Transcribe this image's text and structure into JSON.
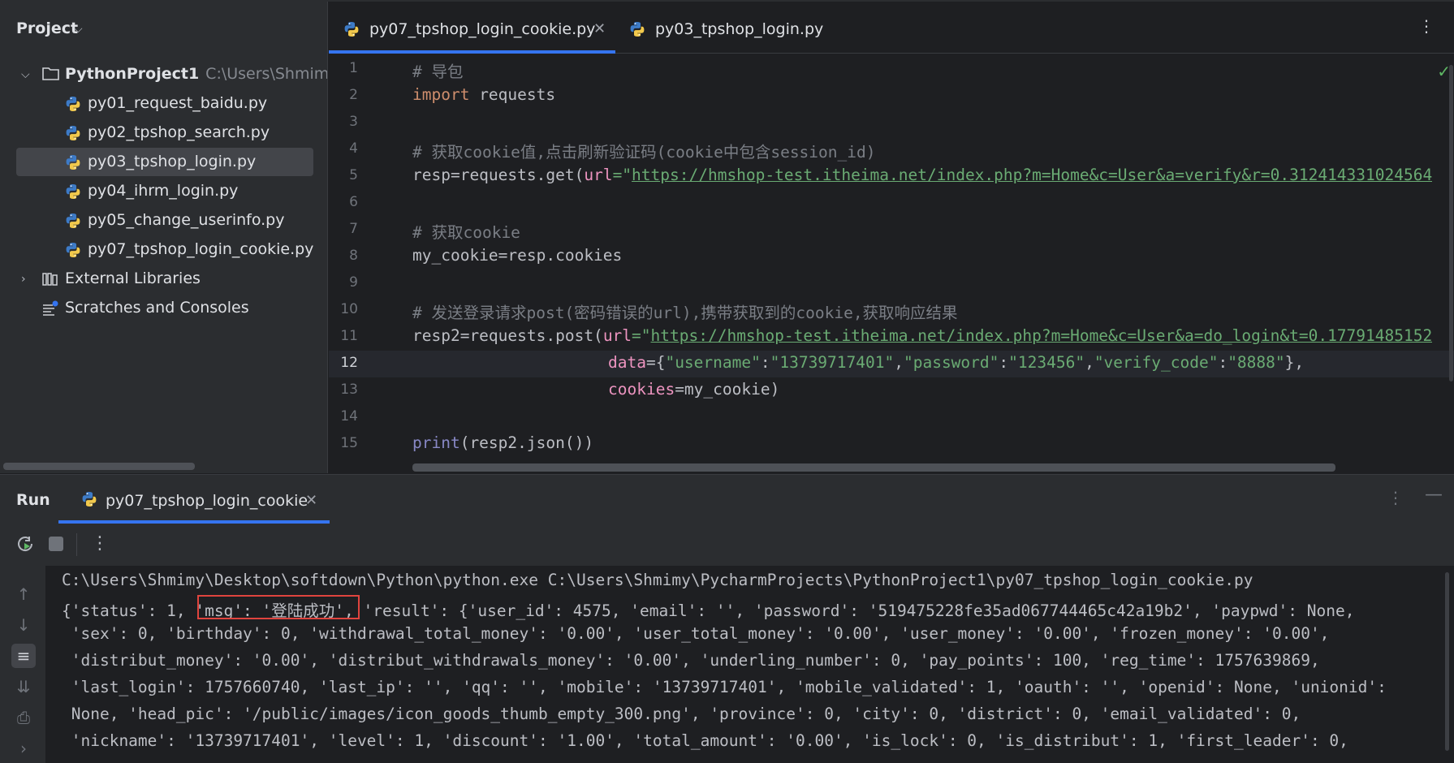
{
  "project_panel": {
    "title": "Project",
    "root": {
      "name": "PythonProject1",
      "path": "C:\\Users\\Shmimy\\Py"
    },
    "files": [
      "py01_request_baidu.py",
      "py02_tpshop_search.py",
      "py03_tpshop_login.py",
      "py04_ihrm_login.py",
      "py05_change_userinfo.py",
      "py07_tpshop_login_cookie.py"
    ],
    "selected_file": "py03_tpshop_login.py",
    "external_libraries": "External Libraries",
    "scratches": "Scratches and Consoles"
  },
  "editor": {
    "tabs": [
      {
        "label": "py07_tpshop_login_cookie.py",
        "active": true
      },
      {
        "label": "py03_tpshop_login.py",
        "active": false
      }
    ],
    "current_line": 12,
    "line_numbers": [
      "1",
      "2",
      "3",
      "4",
      "5",
      "6",
      "7",
      "8",
      "9",
      "10",
      "11",
      "12",
      "13",
      "14",
      "15"
    ],
    "code": {
      "l1": "# 导包",
      "l2_kw": "import",
      "l2_rest": " requests",
      "l4": "# 获取cookie值,点击刷新验证码(cookie中包含session_id)",
      "l5_a": "resp=requests.get(",
      "l5_param": "url",
      "l5_eq": "=\"",
      "l5_url": "https://hmshop-test.itheima.net/index.php?m=Home&c=User&a=verify&r=0.312414331024564",
      "l7": "# 获取cookie",
      "l8": "my_cookie=resp.cookies",
      "l10": "# 发送登录请求post(密码错误的url),携带获取到的cookie,获取响应结果",
      "l11_a": "resp2=requests.post(",
      "l11_param": "url",
      "l11_eq": "=\"",
      "l11_url": "https://hmshop-test.itheima.net/index.php?m=Home&c=User&a=do_login&t=0.17791485152",
      "l12_param": "data",
      "l12_a": "={",
      "l12_k1": "\"username\"",
      "l12_v1": "\"13739717401\"",
      "l12_k2": "\"password\"",
      "l12_v2": "\"123456\"",
      "l12_k3": "\"verify_code\"",
      "l12_v3": "\"8888\"",
      "l12_end": "},",
      "l13_param": "cookies",
      "l13_rest": "=my_cookie)",
      "l15_fn": "print",
      "l15_rest": "(resp2.json())"
    }
  },
  "run_panel": {
    "title": "Run",
    "tab_label": "py07_tpshop_login_cookie",
    "console": [
      "C:\\Users\\Shmimy\\Desktop\\softdown\\Python\\python.exe C:\\Users\\Shmimy\\PycharmProjects\\PythonProject1\\py07_tpshop_login_cookie.py",
      "{'status': 1, 'msg': '登陆成功', 'result': {'user_id': 4575, 'email': '', 'password': '519475228fe35ad067744465c42a19b2', 'paypwd': None,",
      " 'sex': 0, 'birthday': 0, 'withdrawal_total_money': '0.00', 'user_total_money': '0.00', 'user_money': '0.00', 'frozen_money': '0.00',",
      " 'distribut_money': '0.00', 'distribut_withdrawals_money': '0.00', 'underling_number': 0, 'pay_points': 100, 'reg_time': 1757639869,",
      " 'last_login': 1757660740, 'last_ip': '', 'qq': '', 'mobile': '13739717401', 'mobile_validated': 1, 'oauth': '', 'openid': None, 'unionid':",
      " None, 'head_pic': '/public/images/icon_goods_thumb_empty_300.png', 'province': 0, 'city': 0, 'district': 0, 'email_validated': 0,",
      " 'nickname': '13739717401', 'level': 1, 'discount': '1.00', 'total_amount': '0.00', 'is_lock': 0, 'is_distribut': 1, 'first_leader': 0,"
    ],
    "highlight_color": "#e0443e"
  },
  "icons": {
    "python_file": "python-file-icon",
    "folder": "folder-icon",
    "library": "library-icon",
    "scratches": "scratches-icon",
    "rerun": "rerun-icon",
    "stop": "stop-icon",
    "more": "more-vertical-icon",
    "check": "check-icon"
  },
  "colors": {
    "accent": "#3574f0",
    "comment": "#7a7e85",
    "keyword": "#cf8e6d",
    "string": "#6aab73",
    "param": "#ed94c0"
  }
}
